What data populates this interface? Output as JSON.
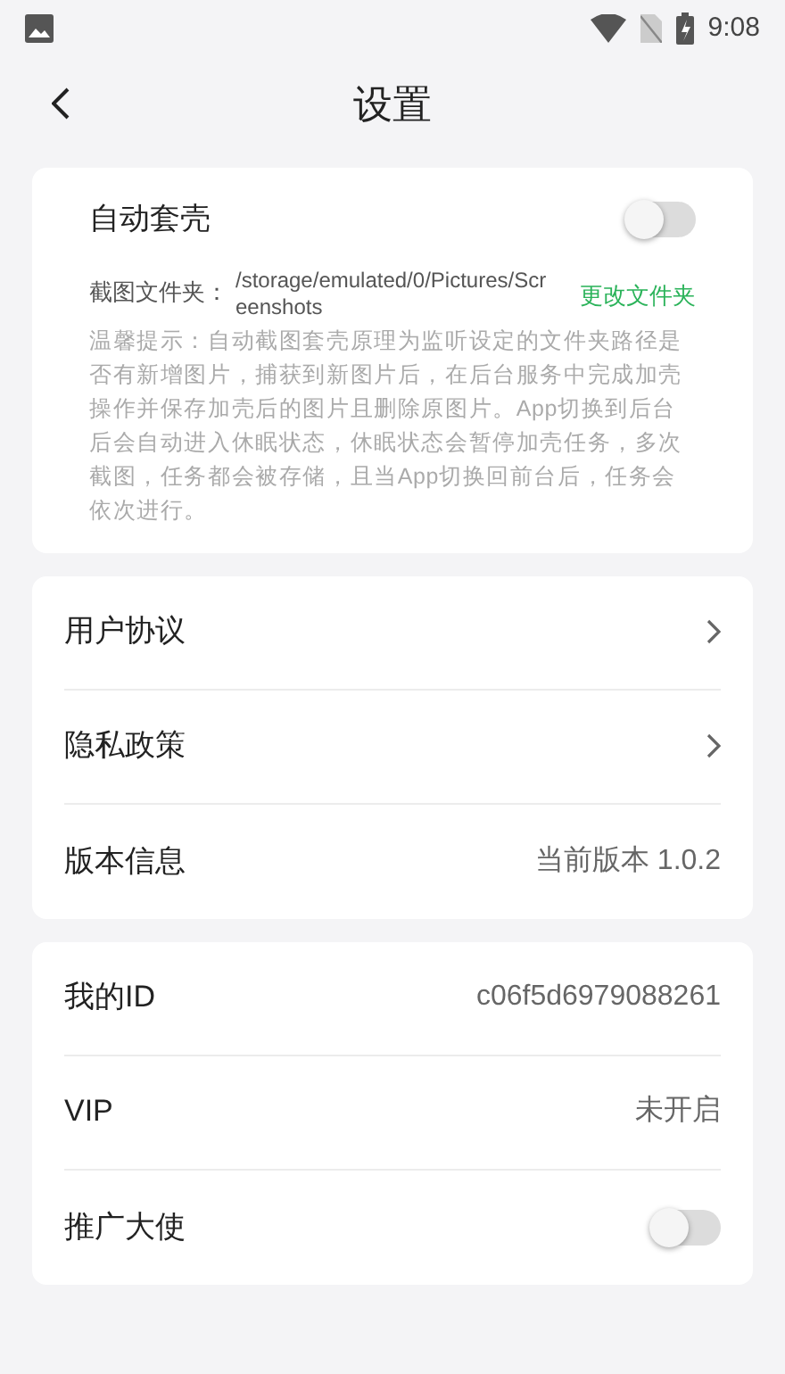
{
  "status_bar": {
    "time": "9:08"
  },
  "header": {
    "title": "设置"
  },
  "auto_shell": {
    "label": "自动套壳",
    "on": false,
    "folder_label": "截图文件夹：",
    "folder_path": "/storage/emulated/0/Pictures/Screenshots",
    "change_link": "更改文件夹",
    "hint": "温馨提示：自动截图套壳原理为监听设定的文件夹路径是否有新增图片，捕获到新图片后，在后台服务中完成加壳操作并保存加壳后的图片且删除原图片。App切换到后台后会自动进入休眠状态，休眠状态会暂停加壳任务，多次截图，任务都会被存储，且当App切换回前台后，任务会依次进行。"
  },
  "groups": [
    {
      "rows": [
        {
          "kind": "chevron",
          "label": "用户协议"
        },
        {
          "kind": "chevron",
          "label": "隐私政策"
        },
        {
          "kind": "value",
          "label": "版本信息",
          "value": "当前版本 1.0.2"
        }
      ]
    },
    {
      "rows": [
        {
          "kind": "value",
          "label": "我的ID",
          "value": "c06f5d6979088261"
        },
        {
          "kind": "value",
          "label": "VIP",
          "value": "未开启"
        },
        {
          "kind": "toggle",
          "label": "推广大使",
          "on": false
        }
      ]
    }
  ]
}
